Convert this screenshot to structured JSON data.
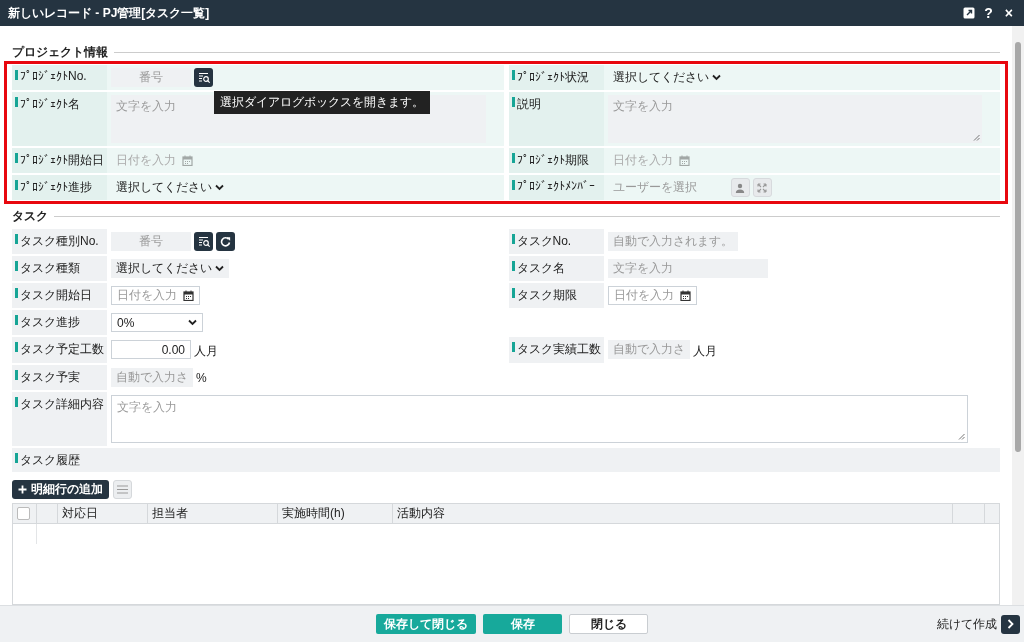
{
  "window": {
    "title": "新しいレコード - PJ管理[タスク一覧]",
    "buttons": [
      "?",
      "×"
    ]
  },
  "sections": [
    {
      "title": "プロジェクト情報",
      "highlighted": true,
      "rows": [
        {
          "left": {
            "label": "ﾌﾟﾛｼﾞｪｸﾄNo.",
            "kind": "lookup",
            "placeholder": "番号",
            "refresh_button": false,
            "tooltip": "選択ダイアログボックスを開きます。"
          },
          "right": {
            "label": "ﾌﾟﾛｼﾞｪｸﾄ状況",
            "kind": "select",
            "value": "選択してください"
          }
        },
        {
          "left": {
            "label": "ﾌﾟﾛｼﾞｪｸﾄ名",
            "kind": "textarea",
            "placeholder": "文字を入力",
            "resizable": false
          },
          "right": {
            "label": "説明",
            "kind": "textarea",
            "placeholder": "文字を入力",
            "resizable": true
          }
        },
        {
          "left": {
            "label": "ﾌﾟﾛｼﾞｪｸﾄ開始日",
            "kind": "date",
            "placeholder": "日付を入力",
            "disabled": true
          },
          "right": {
            "label": "ﾌﾟﾛｼﾞｪｸﾄ期限",
            "kind": "date",
            "placeholder": "日付を入力",
            "disabled": true
          }
        },
        {
          "left": {
            "label": "ﾌﾟﾛｼﾞｪｸﾄ進捗",
            "kind": "select",
            "value": "選択してください"
          },
          "right": {
            "label": "ﾌﾟﾛｼﾞｪｸﾄﾒﾝﾊﾞｰ",
            "kind": "user",
            "placeholder": "ユーザーを選択"
          }
        }
      ]
    },
    {
      "title": "タスク",
      "highlighted": false,
      "rows": [
        {
          "left": {
            "label": "タスク種別No.",
            "kind": "lookup",
            "placeholder": "番号",
            "refresh_button": true
          },
          "right": {
            "label": "タスクNo.",
            "kind": "auto",
            "placeholder": "自動で入力されます。"
          }
        },
        {
          "left": {
            "label": "タスク種類",
            "kind": "select",
            "value": "選択してください"
          },
          "right": {
            "label": "タスク名",
            "kind": "text",
            "placeholder": "文字を入力"
          }
        },
        {
          "left": {
            "label": "タスク開始日",
            "kind": "date",
            "placeholder": "日付を入力",
            "disabled": false
          },
          "right": {
            "label": "タスク期限",
            "kind": "date",
            "placeholder": "日付を入力",
            "disabled": false
          }
        },
        {
          "left": {
            "label": "タスク進捗",
            "kind": "dropdown",
            "value": "0%"
          }
        },
        {
          "left": {
            "label": "タスク予定工数",
            "kind": "number",
            "value": "0.00",
            "unit": "人月"
          },
          "right": {
            "label": "タスク実績工数",
            "kind": "auto",
            "placeholder": "自動で入力さ",
            "unit": "人月"
          }
        },
        {
          "left": {
            "label": "タスク予実",
            "kind": "auto",
            "placeholder": "自動で入力さ",
            "unit": "%"
          }
        },
        {
          "full": {
            "label": "タスク詳細内容",
            "kind": "textarea",
            "placeholder": "文字を入力",
            "resizable": true
          }
        },
        {
          "full": {
            "label": "タスク履歴",
            "kind": "heading"
          }
        }
      ]
    }
  ],
  "history": {
    "add_button": "明細行の追加",
    "select_all": {
      "checked": false
    },
    "columns": [
      "対応日",
      "担当者",
      "実施時間(h)",
      "活動内容"
    ]
  },
  "footer": {
    "buttons": [
      {
        "label": "保存して閉じる",
        "kind": "primary"
      },
      {
        "label": "保存",
        "kind": "primary"
      },
      {
        "label": "閉じる",
        "kind": "secondary"
      }
    ],
    "continue": "続けて作成"
  }
}
